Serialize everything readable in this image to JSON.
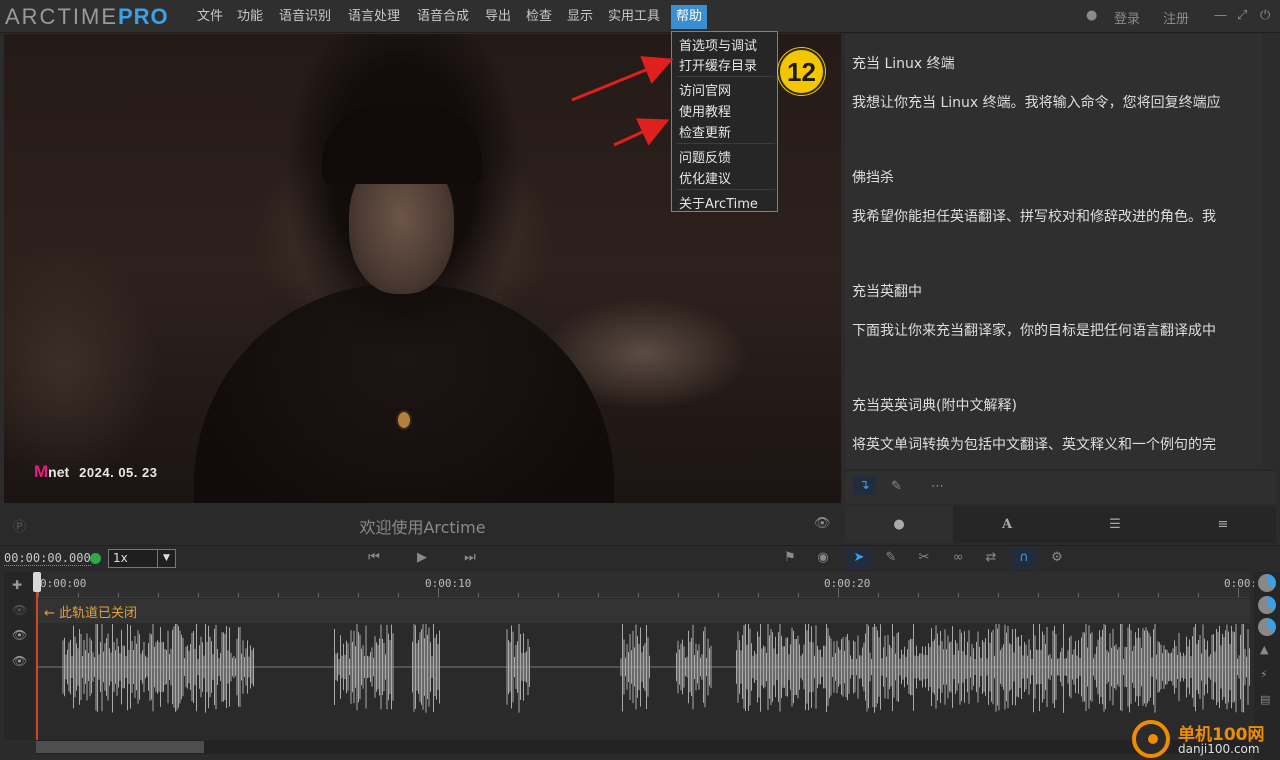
{
  "app": {
    "logo_main": "ARCTIME",
    "logo_pro": "PRO"
  },
  "menu": {
    "items": [
      "文件",
      "功能",
      "语音识别",
      "语言处理",
      "语音合成",
      "导出",
      "检查",
      "显示",
      "实用工具",
      "帮助"
    ],
    "active": "帮助",
    "login": "登录",
    "register": "注册"
  },
  "help_menu": {
    "items": [
      "首选项与调试",
      "打开缓存目录",
      "访问官网",
      "使用教程",
      "检查更新",
      "问题反馈",
      "优化建议",
      "关于ArcTime"
    ]
  },
  "annotation": {
    "badge": "12"
  },
  "video": {
    "watermark_logo_m": "M",
    "watermark_logo_rest": "net",
    "watermark_date": "2024. 05. 23",
    "caption": "欢迎使用Arctime"
  },
  "prompts": [
    {
      "title": "充当 Linux 终端",
      "body": "我想让你充当 Linux 终端。我将输入命令，您将回复终端应"
    },
    {
      "title": "佛挡杀",
      "body": "我希望你能担任英语翻译、拼写校对和修辞改进的角色。我"
    },
    {
      "title": "充当英翻中",
      "body": "下面我让你来充当翻译家，你的目标是把任何语言翻译成中"
    },
    {
      "title": "充当英英词典(附中文解释)",
      "body": "将英文单词转换为包括中文翻译、英文释义和一个例句的完"
    }
  ],
  "transport": {
    "timecode": "00:00:00.000",
    "speed": "1x"
  },
  "timeline": {
    "tick_labels": [
      "0:00:00",
      "0:00:10",
      "0:00:20",
      "0:00:"
    ],
    "closed_track_label": "← 此轨道已关闭"
  },
  "site_watermark": {
    "name": "单机100网",
    "url": "danji100.com"
  },
  "colors": {
    "accent": "#3aa0e8",
    "menu_active": "#3a8fd3",
    "badge": "#f3c600",
    "arrow": "#e0201c",
    "track_closed_label": "#e0a23c",
    "playhead": "#d0471f",
    "waveform": "#a9a9a9"
  }
}
